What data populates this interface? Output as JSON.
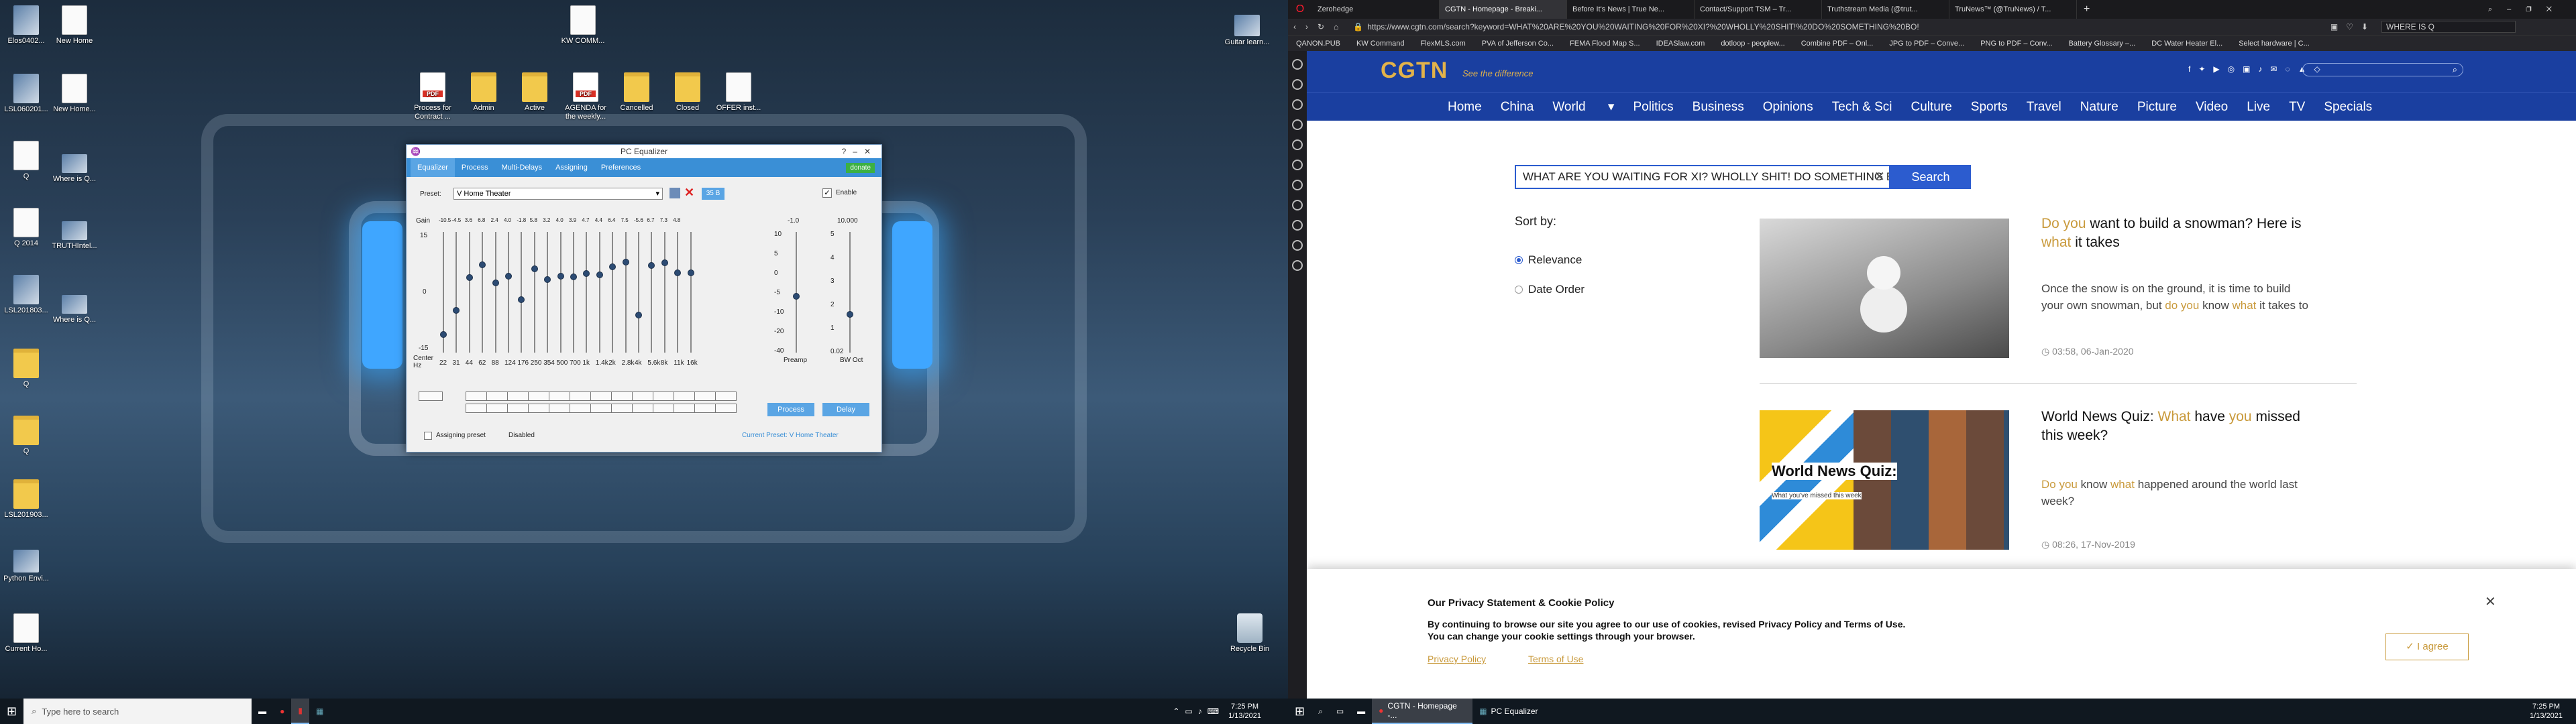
{
  "desktop_left": {
    "icons": [
      {
        "label": "Elos0402..."
      },
      {
        "label": "New Home"
      },
      {
        "label": "LSL060201..."
      },
      {
        "label": "New Home..."
      },
      {
        "label": "Q"
      },
      {
        "label": "Where is Q..."
      },
      {
        "label": "Q 2014"
      },
      {
        "label": "TRUTHIntel..."
      },
      {
        "label": "LSL201803..."
      },
      {
        "label": "Where is Q..."
      },
      {
        "label": "Q"
      },
      {
        "label": "Q"
      },
      {
        "label": "LSL201903..."
      },
      {
        "label": "Python Envi..."
      },
      {
        "label": "Current Ho..."
      },
      {
        "label": "KW COMM..."
      },
      {
        "label": "Process for Contract ..."
      },
      {
        "label": "Admin"
      },
      {
        "label": "Active"
      },
      {
        "label": "AGENDA for the weekly..."
      },
      {
        "label": "Cancelled"
      },
      {
        "label": "Closed"
      },
      {
        "label": "OFFER inst..."
      },
      {
        "label": "Guitar learn..."
      },
      {
        "label": "Recycle Bin"
      }
    ]
  },
  "equalizer": {
    "title": "PC Equalizer",
    "tabs": [
      "Equalizer",
      "Process",
      "Multi-Delays",
      "Assigning",
      "Preferences"
    ],
    "donate": "donate",
    "preset_label": "Preset:",
    "preset_value": "V Home Theater",
    "enable_label": "Enable",
    "gain_label": "Gain",
    "gain_values": [
      "-10.5",
      "-4.5",
      "3.6",
      "6.8",
      "2.4",
      "4.0",
      "-1.8",
      "5.8",
      "3.2",
      "4.0",
      "3.9",
      "4.7",
      "4.4",
      "6.4",
      "7.5",
      "-5.6",
      "6.7",
      "7.3",
      "4.8"
    ],
    "axis_labels": [
      "15",
      "0",
      "-15"
    ],
    "center_hz_label": "Center Hz",
    "freqs": [
      "22",
      "31",
      "44",
      "62",
      "88",
      "124",
      "176",
      "250",
      "354",
      "500",
      "700",
      "1k",
      "1.4k",
      "2k",
      "2.8k",
      "4k",
      "5.6k",
      "8k",
      "11k",
      "16k"
    ],
    "preamp_label": "Preamp",
    "preamp_ticks": [
      "10",
      "5",
      "0",
      "-5",
      "-10",
      "-20",
      "-40"
    ],
    "preamp_top": "-1.0",
    "bw_label": "BW Oct",
    "bw_ticks": [
      "5",
      "4",
      "3",
      "2",
      "1",
      "0.02"
    ],
    "bw_top": "10.000",
    "btn_35": "35 B",
    "btn_process": "Process",
    "btn_delay": "Delay",
    "assigning_label": "Assigning preset",
    "disabled_label": "Disabled",
    "current_preset": "Current Preset: V Home Theater"
  },
  "taskbar_left": {
    "search_placeholder": "Type here to search",
    "time": "7:25 PM",
    "date": "1/13/2021"
  },
  "browser": {
    "tabs": [
      "Zerohedge",
      "CGTN - Homepage - Breaki...",
      "Before It's News | True Ne...",
      "Contact/Support TSM – Tr...",
      "Truthstream Media (@trut...",
      "TruNews™ (@TruNews) / T..."
    ],
    "url": "https://www.cgtn.com/search?keyword=WHAT%20ARE%20YOU%20WAITING%20FOR%20XI?%20WHOLLY%20SHIT!%20DO%20SOMETHING%20BO!",
    "side_search": "WHERE IS Q",
    "bookmarks": [
      "QANON.PUB",
      "KW Command",
      "FlexMLS.com",
      "PVA of Jefferson Co...",
      "FEMA Flood Map S...",
      "IDEASlaw.com",
      "dotloop - peoplew...",
      "Combine PDF – Onl...",
      "JPG to PDF – Conve...",
      "PNG to PDF – Conv...",
      "Battery Glossary –...",
      "DC Water Heater El...",
      "Select hardware | C..."
    ]
  },
  "cgtn": {
    "logo": "CGTN",
    "tagline": "See the difference",
    "nav": [
      "Home",
      "China",
      "World",
      "Politics",
      "Business",
      "Opinions",
      "Tech & Sci",
      "Culture",
      "Sports",
      "Travel",
      "Nature",
      "Picture",
      "Video",
      "Live",
      "TV",
      "Specials"
    ],
    "search_value": "WHAT ARE YOU WAITING FOR XI? WHOLLY SHIT! DO SOMETHING BO!",
    "search_button": "Search",
    "sort_by": "Sort by:",
    "sort_relevance": "Relevance",
    "sort_date": "Date Order",
    "results": [
      {
        "title_parts": [
          "Do you",
          "want to build a snowman? Here is",
          "what",
          "it takes"
        ],
        "summary_parts": [
          "Once the snow is on the ground, it is time to build your own snowman, but",
          "do you",
          "know",
          "what",
          "it takes to"
        ],
        "date": "03:58, 06-Jan-2020"
      },
      {
        "title_parts": [
          "World News Quiz:",
          "What",
          "have",
          "you",
          "missed this week?"
        ],
        "summary_parts": [
          "Do you",
          "know",
          "what",
          "happened around the world last week?"
        ],
        "date": "08:26, 17-Nov-2019",
        "thumb_title": "World News Quiz:",
        "thumb_sub": "What you've missed this week"
      }
    ],
    "privacy": {
      "title": "Our Privacy Statement & Cookie Policy",
      "text1": "By continuing to browse our site you agree to our use of cookies, revised Privacy Policy and Terms of Use.",
      "text2": "You can change your cookie settings through your browser.",
      "link1": "Privacy Policy",
      "link2": "Terms of Use",
      "agree": "I agree"
    }
  },
  "taskbar_right": {
    "items": [
      "CGTN - Homepage -...",
      "PC Equalizer"
    ],
    "time": "7:25 PM",
    "date": "1/13/2021"
  },
  "colors": {
    "cgtn_blue": "#1a3fa0",
    "gold": "#c99a3c",
    "eq_tab": "#3a8fd6",
    "search_btn": "#2c5ccf"
  }
}
